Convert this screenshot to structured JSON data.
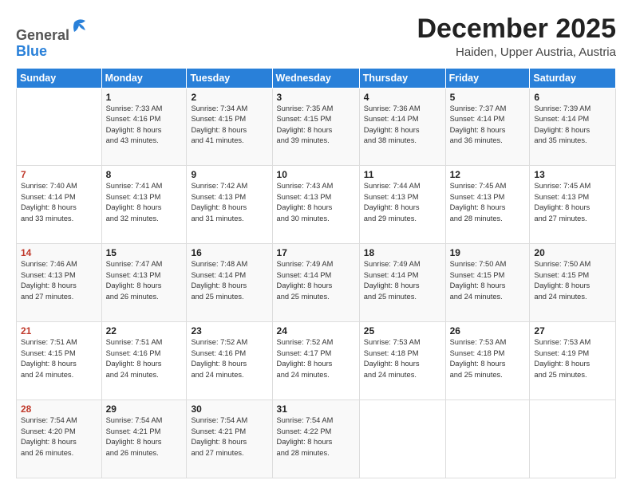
{
  "logo": {
    "line1": "General",
    "line2": "Blue"
  },
  "header": {
    "month_year": "December 2025",
    "location": "Haiden, Upper Austria, Austria"
  },
  "days_of_week": [
    "Sunday",
    "Monday",
    "Tuesday",
    "Wednesday",
    "Thursday",
    "Friday",
    "Saturday"
  ],
  "weeks": [
    [
      {
        "num": "",
        "detail": ""
      },
      {
        "num": "1",
        "detail": "Sunrise: 7:33 AM\nSunset: 4:16 PM\nDaylight: 8 hours\nand 43 minutes."
      },
      {
        "num": "2",
        "detail": "Sunrise: 7:34 AM\nSunset: 4:15 PM\nDaylight: 8 hours\nand 41 minutes."
      },
      {
        "num": "3",
        "detail": "Sunrise: 7:35 AM\nSunset: 4:15 PM\nDaylight: 8 hours\nand 39 minutes."
      },
      {
        "num": "4",
        "detail": "Sunrise: 7:36 AM\nSunset: 4:14 PM\nDaylight: 8 hours\nand 38 minutes."
      },
      {
        "num": "5",
        "detail": "Sunrise: 7:37 AM\nSunset: 4:14 PM\nDaylight: 8 hours\nand 36 minutes."
      },
      {
        "num": "6",
        "detail": "Sunrise: 7:39 AM\nSunset: 4:14 PM\nDaylight: 8 hours\nand 35 minutes."
      }
    ],
    [
      {
        "num": "7",
        "detail": "Sunrise: 7:40 AM\nSunset: 4:14 PM\nDaylight: 8 hours\nand 33 minutes."
      },
      {
        "num": "8",
        "detail": "Sunrise: 7:41 AM\nSunset: 4:13 PM\nDaylight: 8 hours\nand 32 minutes."
      },
      {
        "num": "9",
        "detail": "Sunrise: 7:42 AM\nSunset: 4:13 PM\nDaylight: 8 hours\nand 31 minutes."
      },
      {
        "num": "10",
        "detail": "Sunrise: 7:43 AM\nSunset: 4:13 PM\nDaylight: 8 hours\nand 30 minutes."
      },
      {
        "num": "11",
        "detail": "Sunrise: 7:44 AM\nSunset: 4:13 PM\nDaylight: 8 hours\nand 29 minutes."
      },
      {
        "num": "12",
        "detail": "Sunrise: 7:45 AM\nSunset: 4:13 PM\nDaylight: 8 hours\nand 28 minutes."
      },
      {
        "num": "13",
        "detail": "Sunrise: 7:45 AM\nSunset: 4:13 PM\nDaylight: 8 hours\nand 27 minutes."
      }
    ],
    [
      {
        "num": "14",
        "detail": "Sunrise: 7:46 AM\nSunset: 4:13 PM\nDaylight: 8 hours\nand 27 minutes."
      },
      {
        "num": "15",
        "detail": "Sunrise: 7:47 AM\nSunset: 4:13 PM\nDaylight: 8 hours\nand 26 minutes."
      },
      {
        "num": "16",
        "detail": "Sunrise: 7:48 AM\nSunset: 4:14 PM\nDaylight: 8 hours\nand 25 minutes."
      },
      {
        "num": "17",
        "detail": "Sunrise: 7:49 AM\nSunset: 4:14 PM\nDaylight: 8 hours\nand 25 minutes."
      },
      {
        "num": "18",
        "detail": "Sunrise: 7:49 AM\nSunset: 4:14 PM\nDaylight: 8 hours\nand 25 minutes."
      },
      {
        "num": "19",
        "detail": "Sunrise: 7:50 AM\nSunset: 4:15 PM\nDaylight: 8 hours\nand 24 minutes."
      },
      {
        "num": "20",
        "detail": "Sunrise: 7:50 AM\nSunset: 4:15 PM\nDaylight: 8 hours\nand 24 minutes."
      }
    ],
    [
      {
        "num": "21",
        "detail": "Sunrise: 7:51 AM\nSunset: 4:15 PM\nDaylight: 8 hours\nand 24 minutes."
      },
      {
        "num": "22",
        "detail": "Sunrise: 7:51 AM\nSunset: 4:16 PM\nDaylight: 8 hours\nand 24 minutes."
      },
      {
        "num": "23",
        "detail": "Sunrise: 7:52 AM\nSunset: 4:16 PM\nDaylight: 8 hours\nand 24 minutes."
      },
      {
        "num": "24",
        "detail": "Sunrise: 7:52 AM\nSunset: 4:17 PM\nDaylight: 8 hours\nand 24 minutes."
      },
      {
        "num": "25",
        "detail": "Sunrise: 7:53 AM\nSunset: 4:18 PM\nDaylight: 8 hours\nand 24 minutes."
      },
      {
        "num": "26",
        "detail": "Sunrise: 7:53 AM\nSunset: 4:18 PM\nDaylight: 8 hours\nand 25 minutes."
      },
      {
        "num": "27",
        "detail": "Sunrise: 7:53 AM\nSunset: 4:19 PM\nDaylight: 8 hours\nand 25 minutes."
      }
    ],
    [
      {
        "num": "28",
        "detail": "Sunrise: 7:54 AM\nSunset: 4:20 PM\nDaylight: 8 hours\nand 26 minutes."
      },
      {
        "num": "29",
        "detail": "Sunrise: 7:54 AM\nSunset: 4:21 PM\nDaylight: 8 hours\nand 26 minutes."
      },
      {
        "num": "30",
        "detail": "Sunrise: 7:54 AM\nSunset: 4:21 PM\nDaylight: 8 hours\nand 27 minutes."
      },
      {
        "num": "31",
        "detail": "Sunrise: 7:54 AM\nSunset: 4:22 PM\nDaylight: 8 hours\nand 28 minutes."
      },
      {
        "num": "",
        "detail": ""
      },
      {
        "num": "",
        "detail": ""
      },
      {
        "num": "",
        "detail": ""
      }
    ]
  ]
}
